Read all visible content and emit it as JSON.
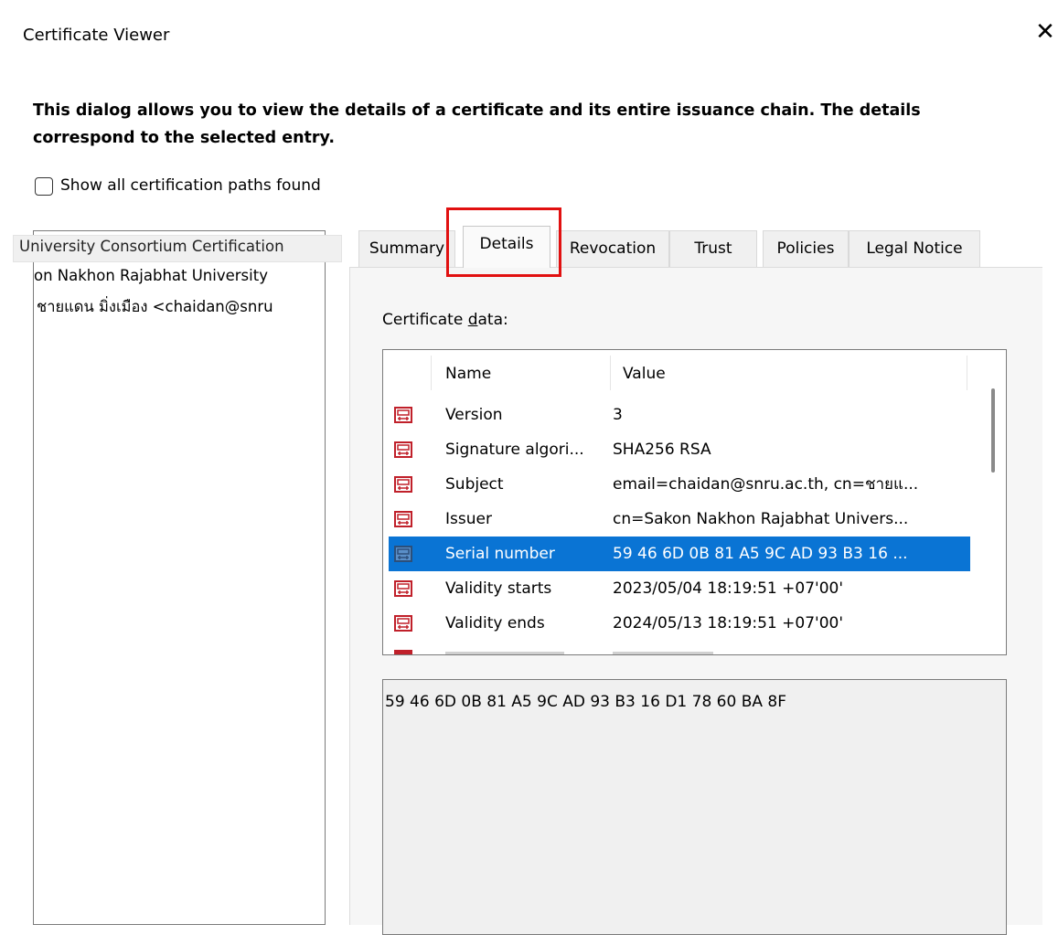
{
  "window": {
    "title": "Certificate Viewer",
    "close_glyph": "✕"
  },
  "description": "This dialog allows you to view the details of a certificate and its entire issuance chain. The details correspond to the selected entry.",
  "show_all_paths": {
    "label": "Show all certification paths found",
    "checked": false
  },
  "chain": [
    "University Consortium Certification",
    "on Nakhon Rajabhat University",
    "ชายแดน มิ่งเมือง  <chaidan@snru"
  ],
  "tabs": [
    {
      "label": "Summary"
    },
    {
      "label": "Details",
      "active": true
    },
    {
      "label": "Revocation"
    },
    {
      "label": "Trust"
    },
    {
      "label": "Policies"
    },
    {
      "label": "Legal Notice"
    }
  ],
  "details": {
    "label_prefix": "Certificate ",
    "label_mnemonic": "d",
    "label_suffix": "ata:",
    "columns": {
      "name": "Name",
      "value": "Value"
    },
    "rows": [
      {
        "name": "Version",
        "value": "3"
      },
      {
        "name": "Signature algori...",
        "value": "SHA256 RSA"
      },
      {
        "name": "Subject",
        "value": "email=chaidan@snru.ac.th, cn=ชายแ..."
      },
      {
        "name": "Issuer",
        "value": "cn=Sakon Nakhon Rajabhat Univers..."
      },
      {
        "name": "Serial number",
        "value": "59 46 6D 0B 81 A5 9C AD 93 B3 16 ...",
        "selected": true
      },
      {
        "name": "Validity starts",
        "value": "2023/05/04 18:19:51 +07'00'"
      },
      {
        "name": "Validity ends",
        "value": "2024/05/13 18:19:51 +07'00'"
      }
    ],
    "selected_value_full": "59 46 6D 0B 81 A5 9C AD 93 B3 16 D1 78 60 BA 8F"
  },
  "colors": {
    "selection": "#0a74d4",
    "highlight_box": "#e11010",
    "icon_red": "#c0202a"
  },
  "icons": {
    "certificate_row": "certificate-icon"
  }
}
